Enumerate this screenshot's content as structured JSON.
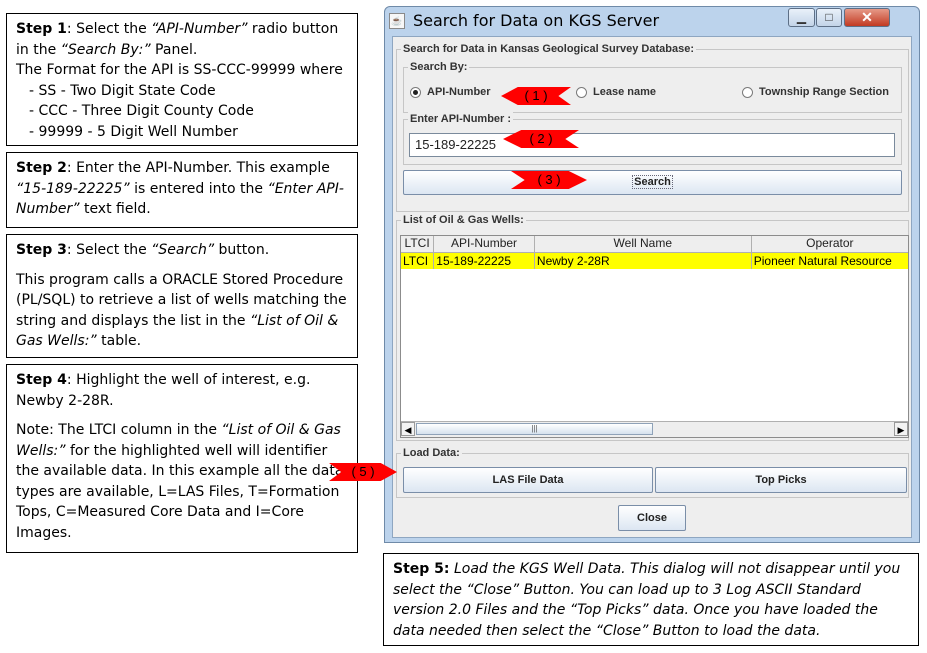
{
  "step1": {
    "label": "Step 1",
    "t1": ": Select the ",
    "em1": "“API-Number”",
    "t2": " radio button in the ",
    "em2": "“Search By:”",
    "t3": " Panel.",
    "line2": "The Format for the API is SS-CCC-99999 where",
    "items": [
      "- SS - Two Digit State Code",
      "- CCC - Three Digit County Code",
      "- 99999 - 5 Digit Well Number"
    ]
  },
  "step2": {
    "label": "Step 2",
    "t1": ": Enter the API-Number. This example ",
    "em1": "“15-189-22225”",
    "t2": " is entered into the ",
    "em2": "“Enter API-Number”",
    "t3": " text field."
  },
  "step3": {
    "label": "Step 3",
    "t1": ": Select the ",
    "em1": "“Search”",
    "t2": " button.",
    "p2a": "This program calls a ORACLE Stored Procedure (PL/SQL) to retrieve a list of wells matching the string and displays the list in the ",
    "p2em": "“List of Oil & Gas Wells:”",
    "p2b": " table."
  },
  "step4": {
    "label": "Step 4",
    "t1": ": Highlight the well of interest, e.g. Newby 2-28R.",
    "p2a": "Note: The LTCI column in the ",
    "p2em": "“List of Oil & Gas Wells:”",
    "p2b": " for the highlighted well will identifier the available data. In this example all the data types are available, L=LAS Files, T=Formation Tops, C=Measured Core Data and I=Core Images."
  },
  "step5": {
    "label": "Step 5:",
    "text": " Load the KGS Well Data.  This dialog will not disappear until you select the “Close” Button.  You can load up to 3 Log ASCII Standard version 2.0 Files and the “Top Picks” data.  Once you have loaded the data needed then select the “Close” Button to load the data."
  },
  "window": {
    "title": "Search for Data on KGS Server",
    "db_panel": "Search for Data in Kansas Geological Survey Database:",
    "search_by": "Search By:",
    "radio_api": "API-Number",
    "radio_lease": "Lease name",
    "radio_trs": "Township Range Section",
    "api_panel": "Enter API-Number :",
    "api_value": "15-189-22225",
    "search_button": "Search",
    "list_panel": "List of Oil & Gas Wells:",
    "columns": [
      "LTCI",
      "API-Number",
      "Well Name",
      "Operator"
    ],
    "row": [
      "LTCI",
      "15-189-22225",
      "Newby 2-28R",
      "Pioneer Natural Resource"
    ],
    "scroll_grip": "|||",
    "load_panel": "Load Data:",
    "las_button": "LAS File Data",
    "top_button": "Top Picks",
    "close_button": "Close"
  },
  "callouts": [
    "( 1 )",
    "( 2 )",
    "( 3 )",
    "( 5 )"
  ],
  "colors": {
    "highlight_row": "#ffff00",
    "callout_arrow": "#ff0000",
    "window_frame": "#bcd3ec"
  },
  "icons": [
    "java-app-icon",
    "minimize-icon",
    "maximize-icon",
    "close-icon",
    "scroll-left-icon",
    "scroll-right-icon"
  ]
}
